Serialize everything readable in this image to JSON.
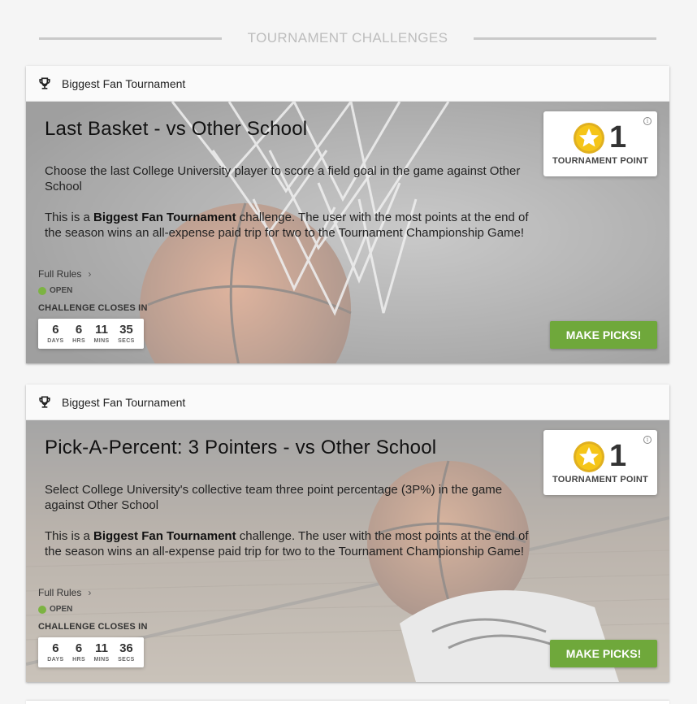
{
  "section": {
    "title": "TOURNAMENT CHALLENGES"
  },
  "colors": {
    "accent_green": "#6fa83b",
    "open_dot": "#7cb342",
    "star_gold": "#f5c518"
  },
  "icons": {
    "trophy": "trophy-icon",
    "star": "star-icon",
    "info": "info-icon",
    "chevron": "chevron-right-icon"
  },
  "cards": [
    {
      "org": "Biggest Fan Tournament",
      "title": "Last Basket - vs Other School",
      "description": "Choose the last College University player to score a field goal in the game against Other School",
      "promo_prefix": "This is a ",
      "promo_bold": "Biggest Fan Tournament",
      "promo_suffix": " challenge. The user with the most points at the end of the season wins an all-expense paid trip for two to the Tournament Championship Game!",
      "full_rules": "Full Rules",
      "status": "OPEN",
      "closes_label": "CHALLENGE CLOSES IN",
      "countdown": {
        "days": "6",
        "hrs": "6",
        "mins": "11",
        "secs": "35",
        "days_lbl": "DAYS",
        "hrs_lbl": "HRS",
        "mins_lbl": "MINS",
        "secs_lbl": "SECS"
      },
      "points": "1",
      "points_label": "TOURNAMENT POINT",
      "button": "MAKE PICKS!"
    },
    {
      "org": "Biggest Fan Tournament",
      "title": "Pick-A-Percent: 3 Pointers - vs Other School",
      "description": "Select College University's collective team three point percentage (3P%) in the game against Other School",
      "promo_prefix": "This is a ",
      "promo_bold": "Biggest Fan Tournament",
      "promo_suffix": " challenge. The user with the most points at the end of the season wins an all-expense paid trip for two to the Tournament Championship Game!",
      "full_rules": "Full Rules",
      "status": "OPEN",
      "closes_label": "CHALLENGE CLOSES IN",
      "countdown": {
        "days": "6",
        "hrs": "6",
        "mins": "11",
        "secs": "36",
        "days_lbl": "DAYS",
        "hrs_lbl": "HRS",
        "mins_lbl": "MINS",
        "secs_lbl": "SECS"
      },
      "points": "1",
      "points_label": "TOURNAMENT POINT",
      "button": "MAKE PICKS!"
    }
  ]
}
